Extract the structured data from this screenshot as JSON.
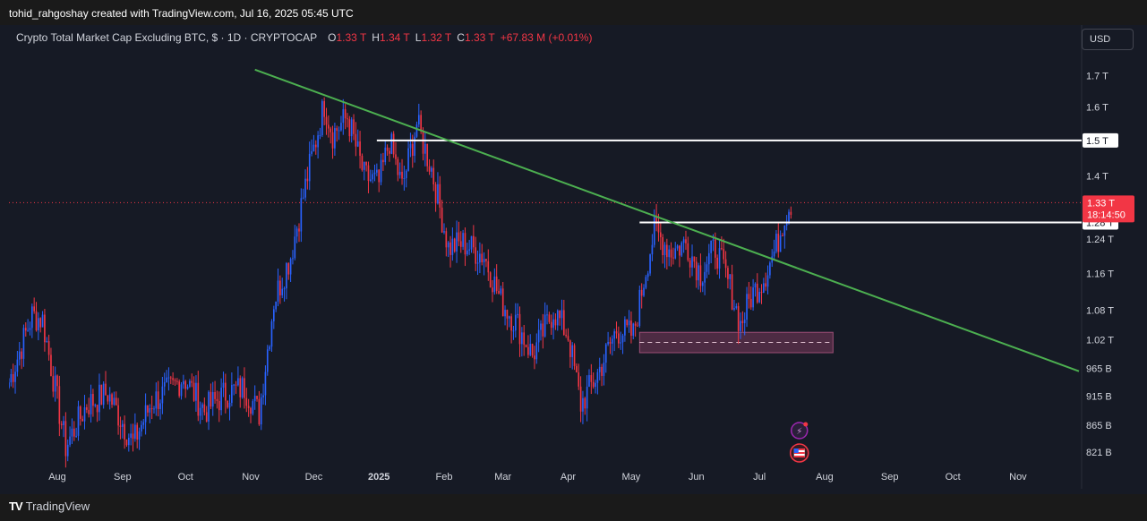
{
  "header": {
    "attribution": "tohid_rahgoshay created with TradingView.com, Jul 16, 2025 05:45 UTC"
  },
  "footer": {
    "brand": "TradingView"
  },
  "legend": {
    "title": "Crypto Total Market Cap Excluding BTC, $ · 1D · CRYPTOCAP",
    "o_label": "O",
    "o_value": "1.33 T",
    "h_label": "H",
    "h_value": "1.34 T",
    "l_label": "L",
    "l_value": "1.32 T",
    "c_label": "C",
    "c_value": "1.33 T",
    "change": "+67.83 M (+0.01%)"
  },
  "currency_button": "USD",
  "colors": {
    "up": "#2962FF",
    "down": "#F23645",
    "trend": "#4CAF50",
    "level": "#FFFFFF",
    "zone": "#7B3A5C",
    "background": "#161A25"
  },
  "chart_data": {
    "type": "candlestick",
    "title": "Crypto Total Market Cap Excluding BTC, $ · 1D · CRYPTOCAP",
    "x_ticks": [
      "Aug",
      "Sep",
      "Oct",
      "Nov",
      "Dec",
      "2025",
      "Feb",
      "Mar",
      "Apr",
      "May",
      "Jun",
      "Jul",
      "Aug",
      "Sep",
      "Oct",
      "Nov"
    ],
    "y_ticks": [
      "1.7 T",
      "1.6 T",
      "1.5 T",
      "1.4 T",
      "1.24 T",
      "1.16 T",
      "1.08 T",
      "1.02 T",
      "965 B",
      "915 B",
      "865 B",
      "821 B"
    ],
    "y_scale": "log",
    "ylim_billions": [
      800,
      1780
    ],
    "x_range": [
      "2024-07-09",
      "2025-11-30"
    ],
    "last_price_label": "1.33 T",
    "countdown": "18:14:50",
    "levels": [
      {
        "label": "1.5 T",
        "value_billions": 1500,
        "from": "2024-12-31"
      },
      {
        "label": "1.28 T",
        "value_billions": 1280,
        "from": "2025-05-05"
      }
    ],
    "trendline": {
      "points": [
        {
          "date": "2024-11-03",
          "value_billions": 1720
        },
        {
          "date": "2025-11-30",
          "value_billions": 960
        }
      ]
    },
    "demand_zone": {
      "from": "2025-05-05",
      "to": "2025-08-05",
      "top_billions": 1035,
      "bottom_billions": 995,
      "mid_billions": 1015
    },
    "series": [
      {
        "date": "2024-07-09",
        "value_billions": 940
      },
      {
        "date": "2024-07-20",
        "value_billions": 1070
      },
      {
        "date": "2024-07-25",
        "value_billions": 1060
      },
      {
        "date": "2024-08-05",
        "value_billions": 830
      },
      {
        "date": "2024-08-15",
        "value_billions": 900
      },
      {
        "date": "2024-08-25",
        "value_billions": 920
      },
      {
        "date": "2024-09-06",
        "value_billions": 835
      },
      {
        "date": "2024-09-15",
        "value_billions": 905
      },
      {
        "date": "2024-09-25",
        "value_billions": 930
      },
      {
        "date": "2024-09-30",
        "value_billions": 950
      },
      {
        "date": "2024-10-10",
        "value_billions": 890
      },
      {
        "date": "2024-10-20",
        "value_billions": 920
      },
      {
        "date": "2024-10-29",
        "value_billions": 930
      },
      {
        "date": "2024-11-05",
        "value_billions": 885
      },
      {
        "date": "2024-11-12",
        "value_billions": 1100
      },
      {
        "date": "2024-11-20",
        "value_billions": 1200
      },
      {
        "date": "2024-11-28",
        "value_billions": 1400
      },
      {
        "date": "2024-12-06",
        "value_billions": 1610
      },
      {
        "date": "2024-12-10",
        "value_billions": 1520
      },
      {
        "date": "2024-12-17",
        "value_billions": 1570
      },
      {
        "date": "2024-12-25",
        "value_billions": 1400
      },
      {
        "date": "2025-01-01",
        "value_billions": 1380
      },
      {
        "date": "2025-01-06",
        "value_billions": 1500
      },
      {
        "date": "2025-01-12",
        "value_billions": 1370
      },
      {
        "date": "2025-01-19",
        "value_billions": 1550
      },
      {
        "date": "2025-01-26",
        "value_billions": 1420
      },
      {
        "date": "2025-02-03",
        "value_billions": 1220
      },
      {
        "date": "2025-02-10",
        "value_billions": 1230
      },
      {
        "date": "2025-02-20",
        "value_billions": 1200
      },
      {
        "date": "2025-02-28",
        "value_billions": 1100
      },
      {
        "date": "2025-03-08",
        "value_billions": 1050
      },
      {
        "date": "2025-03-15",
        "value_billions": 990
      },
      {
        "date": "2025-03-25",
        "value_billions": 1080
      },
      {
        "date": "2025-04-01",
        "value_billions": 1030
      },
      {
        "date": "2025-04-07",
        "value_billions": 900
      },
      {
        "date": "2025-04-15",
        "value_billions": 955
      },
      {
        "date": "2025-04-24",
        "value_billions": 1040
      },
      {
        "date": "2025-05-02",
        "value_billions": 1030
      },
      {
        "date": "2025-05-08",
        "value_billions": 1170
      },
      {
        "date": "2025-05-12",
        "value_billions": 1260
      },
      {
        "date": "2025-05-20",
        "value_billions": 1210
      },
      {
        "date": "2025-05-27",
        "value_billions": 1230
      },
      {
        "date": "2025-06-03",
        "value_billions": 1160
      },
      {
        "date": "2025-06-10",
        "value_billions": 1220
      },
      {
        "date": "2025-06-17",
        "value_billions": 1130
      },
      {
        "date": "2025-06-22",
        "value_billions": 1050
      },
      {
        "date": "2025-06-27",
        "value_billions": 1110
      },
      {
        "date": "2025-07-03",
        "value_billions": 1150
      },
      {
        "date": "2025-07-09",
        "value_billions": 1220
      },
      {
        "date": "2025-07-13",
        "value_billions": 1300
      },
      {
        "date": "2025-07-16",
        "value_billions": 1330
      }
    ]
  }
}
